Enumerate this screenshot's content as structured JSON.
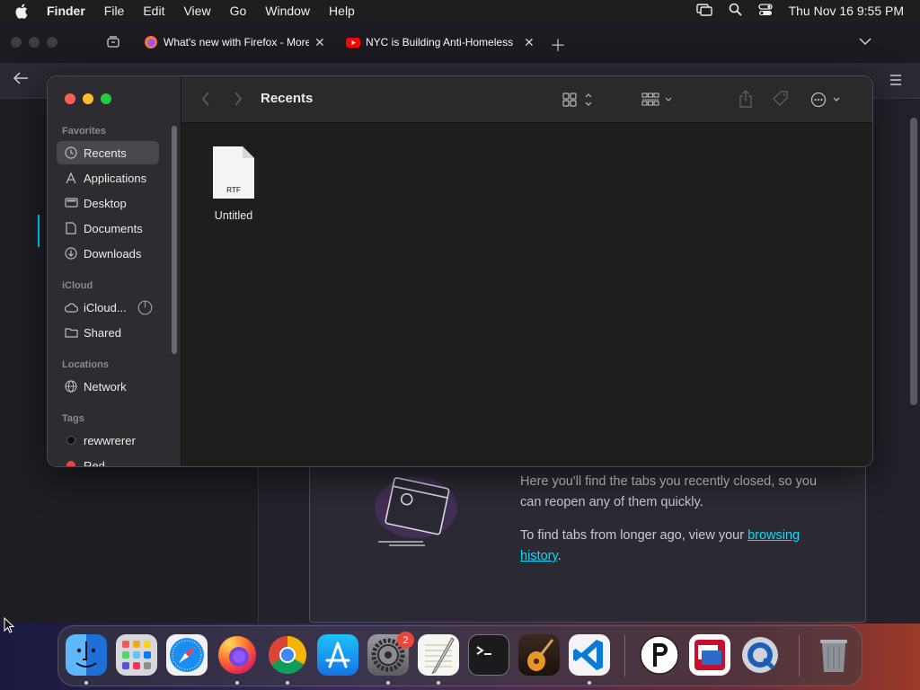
{
  "menubar": {
    "items": [
      "Finder",
      "File",
      "Edit",
      "View",
      "Go",
      "Window",
      "Help"
    ],
    "clock": "Thu Nov 16  9:55 PM"
  },
  "firefox": {
    "tabs": [
      {
        "title": "What's new with Firefox - More",
        "icon": "firefox-icon"
      },
      {
        "title": "NYC is Building Anti-Homeless",
        "icon": "youtube-icon"
      }
    ],
    "recently_closed": {
      "line1": "Here you'll find the tabs you recently closed, so you can reopen any of them quickly.",
      "line2_prefix": "To find tabs from longer ago, view your ",
      "line2_link": "browsing history",
      "line2_suffix": "."
    }
  },
  "finder": {
    "title": "Recents",
    "sidebar": {
      "favorites_label": "Favorites",
      "favorites": [
        {
          "label": "Recents",
          "icon": "clock-icon",
          "selected": true
        },
        {
          "label": "Applications",
          "icon": "applications-icon"
        },
        {
          "label": "Desktop",
          "icon": "desktop-icon"
        },
        {
          "label": "Documents",
          "icon": "document-icon"
        },
        {
          "label": "Downloads",
          "icon": "download-icon"
        }
      ],
      "icloud_label": "iCloud",
      "icloud": [
        {
          "label": "iCloud...",
          "icon": "cloud-icon"
        },
        {
          "label": "Shared",
          "icon": "shared-folder-icon"
        }
      ],
      "locations_label": "Locations",
      "locations": [
        {
          "label": "Network",
          "icon": "network-icon"
        }
      ],
      "tags_label": "Tags",
      "tags": [
        {
          "label": "rewwrerer",
          "color": "#0e0e0e"
        },
        {
          "label": "Red",
          "color": "#e5483f"
        }
      ]
    },
    "files": [
      {
        "name": "Untitled",
        "type": "RTF"
      }
    ]
  },
  "dock": {
    "apps": [
      "Finder",
      "Launchpad",
      "Safari",
      "Firefox",
      "Chrome",
      "App Store",
      "System Settings",
      "TextEdit",
      "Terminal",
      "GarageBand",
      "Visual Studio Code",
      "P",
      "Screens",
      "QuickTime",
      "Trash"
    ],
    "settings_badge": "2"
  },
  "colors": {
    "accent": "#00ddff",
    "close": "#ff5f57",
    "minimize": "#febc2e",
    "zoom": "#28c840"
  }
}
